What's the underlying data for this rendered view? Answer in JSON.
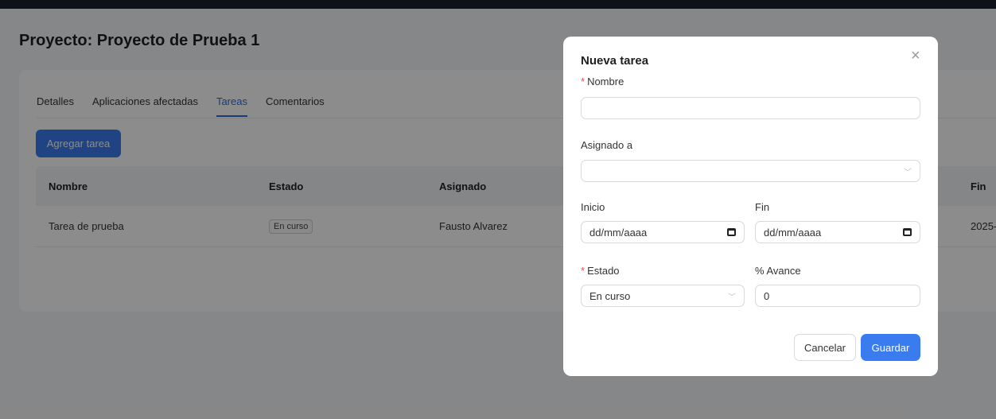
{
  "page": {
    "title": "Proyecto: Proyecto de Prueba 1"
  },
  "tabs": [
    {
      "label": "Detalles",
      "active": false
    },
    {
      "label": "Aplicaciones afectadas",
      "active": false
    },
    {
      "label": "Tareas",
      "active": true
    },
    {
      "label": "Comentarios",
      "active": false
    }
  ],
  "toolbar": {
    "add_task_label": "Agregar tarea"
  },
  "table": {
    "headers": [
      "Nombre",
      "Estado",
      "Asignado",
      "Fin"
    ],
    "rows": [
      {
        "nombre": "Tarea de prueba",
        "estado": "En curso",
        "asignado": "Fausto Alvarez",
        "fin": "2025-"
      }
    ]
  },
  "modal": {
    "title": "Nueva tarea",
    "close_icon": "close-icon",
    "nombre": {
      "label": "Nombre",
      "required": true,
      "value": ""
    },
    "asignado": {
      "label": "Asignado a",
      "value": ""
    },
    "inicio": {
      "label": "Inicio",
      "placeholder": "dd/mm/aaaa"
    },
    "fin": {
      "label": "Fin",
      "placeholder": "dd/mm/aaaa"
    },
    "estado": {
      "label": "Estado",
      "required": true,
      "value": "En curso"
    },
    "avance": {
      "label": "% Avance",
      "value": "0"
    },
    "cancel_label": "Cancelar",
    "save_label": "Guardar"
  },
  "colors": {
    "accent": "#3b7bf0",
    "required": "#ff4d4f"
  }
}
